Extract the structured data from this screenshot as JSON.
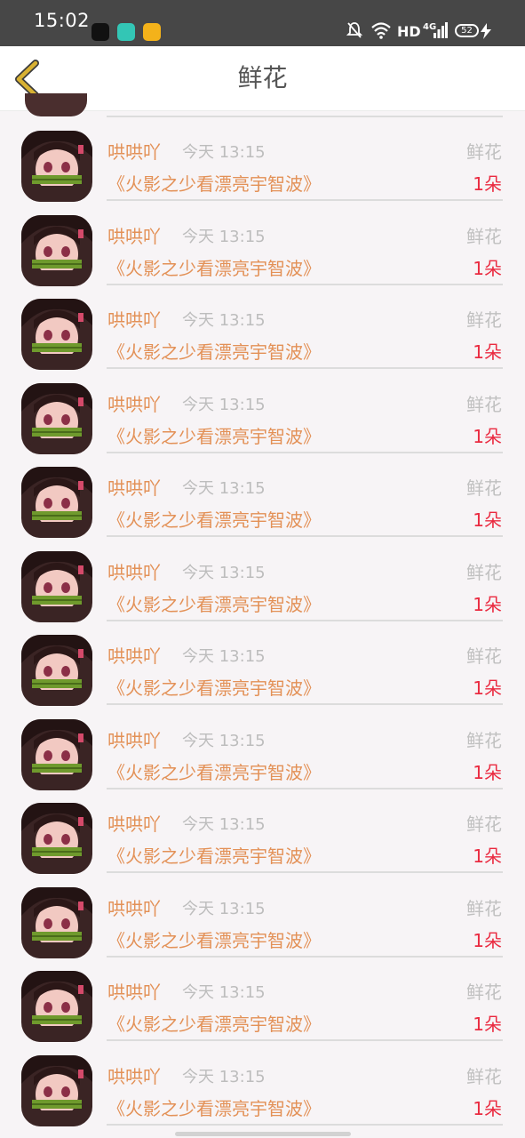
{
  "status_bar": {
    "time": "15:02",
    "hd_label": "HD",
    "network_label": "4G",
    "battery_level": "52"
  },
  "header": {
    "title": "鲜花",
    "back_icon": "chevron-left-icon",
    "accent_color": "#d8b133"
  },
  "colors": {
    "name": "#e39157",
    "count": "#ea2a40",
    "muted": "#bdbdbd"
  },
  "gifts": [
    {
      "user": "哄哄吖",
      "time": "今天 13:15",
      "gift_type": "鲜花",
      "book": "《火影之少看漂亮宇智波》",
      "count": "1朵"
    },
    {
      "user": "哄哄吖",
      "time": "今天 13:15",
      "gift_type": "鲜花",
      "book": "《火影之少看漂亮宇智波》",
      "count": "1朵"
    },
    {
      "user": "哄哄吖",
      "time": "今天 13:15",
      "gift_type": "鲜花",
      "book": "《火影之少看漂亮宇智波》",
      "count": "1朵"
    },
    {
      "user": "哄哄吖",
      "time": "今天 13:15",
      "gift_type": "鲜花",
      "book": "《火影之少看漂亮宇智波》",
      "count": "1朵"
    },
    {
      "user": "哄哄吖",
      "time": "今天 13:15",
      "gift_type": "鲜花",
      "book": "《火影之少看漂亮宇智波》",
      "count": "1朵"
    },
    {
      "user": "哄哄吖",
      "time": "今天 13:15",
      "gift_type": "鲜花",
      "book": "《火影之少看漂亮宇智波》",
      "count": "1朵"
    },
    {
      "user": "哄哄吖",
      "time": "今天 13:15",
      "gift_type": "鲜花",
      "book": "《火影之少看漂亮宇智波》",
      "count": "1朵"
    },
    {
      "user": "哄哄吖",
      "time": "今天 13:15",
      "gift_type": "鲜花",
      "book": "《火影之少看漂亮宇智波》",
      "count": "1朵"
    },
    {
      "user": "哄哄吖",
      "time": "今天 13:15",
      "gift_type": "鲜花",
      "book": "《火影之少看漂亮宇智波》",
      "count": "1朵"
    },
    {
      "user": "哄哄吖",
      "time": "今天 13:15",
      "gift_type": "鲜花",
      "book": "《火影之少看漂亮宇智波》",
      "count": "1朵"
    },
    {
      "user": "哄哄吖",
      "time": "今天 13:15",
      "gift_type": "鲜花",
      "book": "《火影之少看漂亮宇智波》",
      "count": "1朵"
    },
    {
      "user": "哄哄吖",
      "time": "今天 13:15",
      "gift_type": "鲜花",
      "book": "《火影之少看漂亮宇智波》",
      "count": "1朵"
    }
  ]
}
